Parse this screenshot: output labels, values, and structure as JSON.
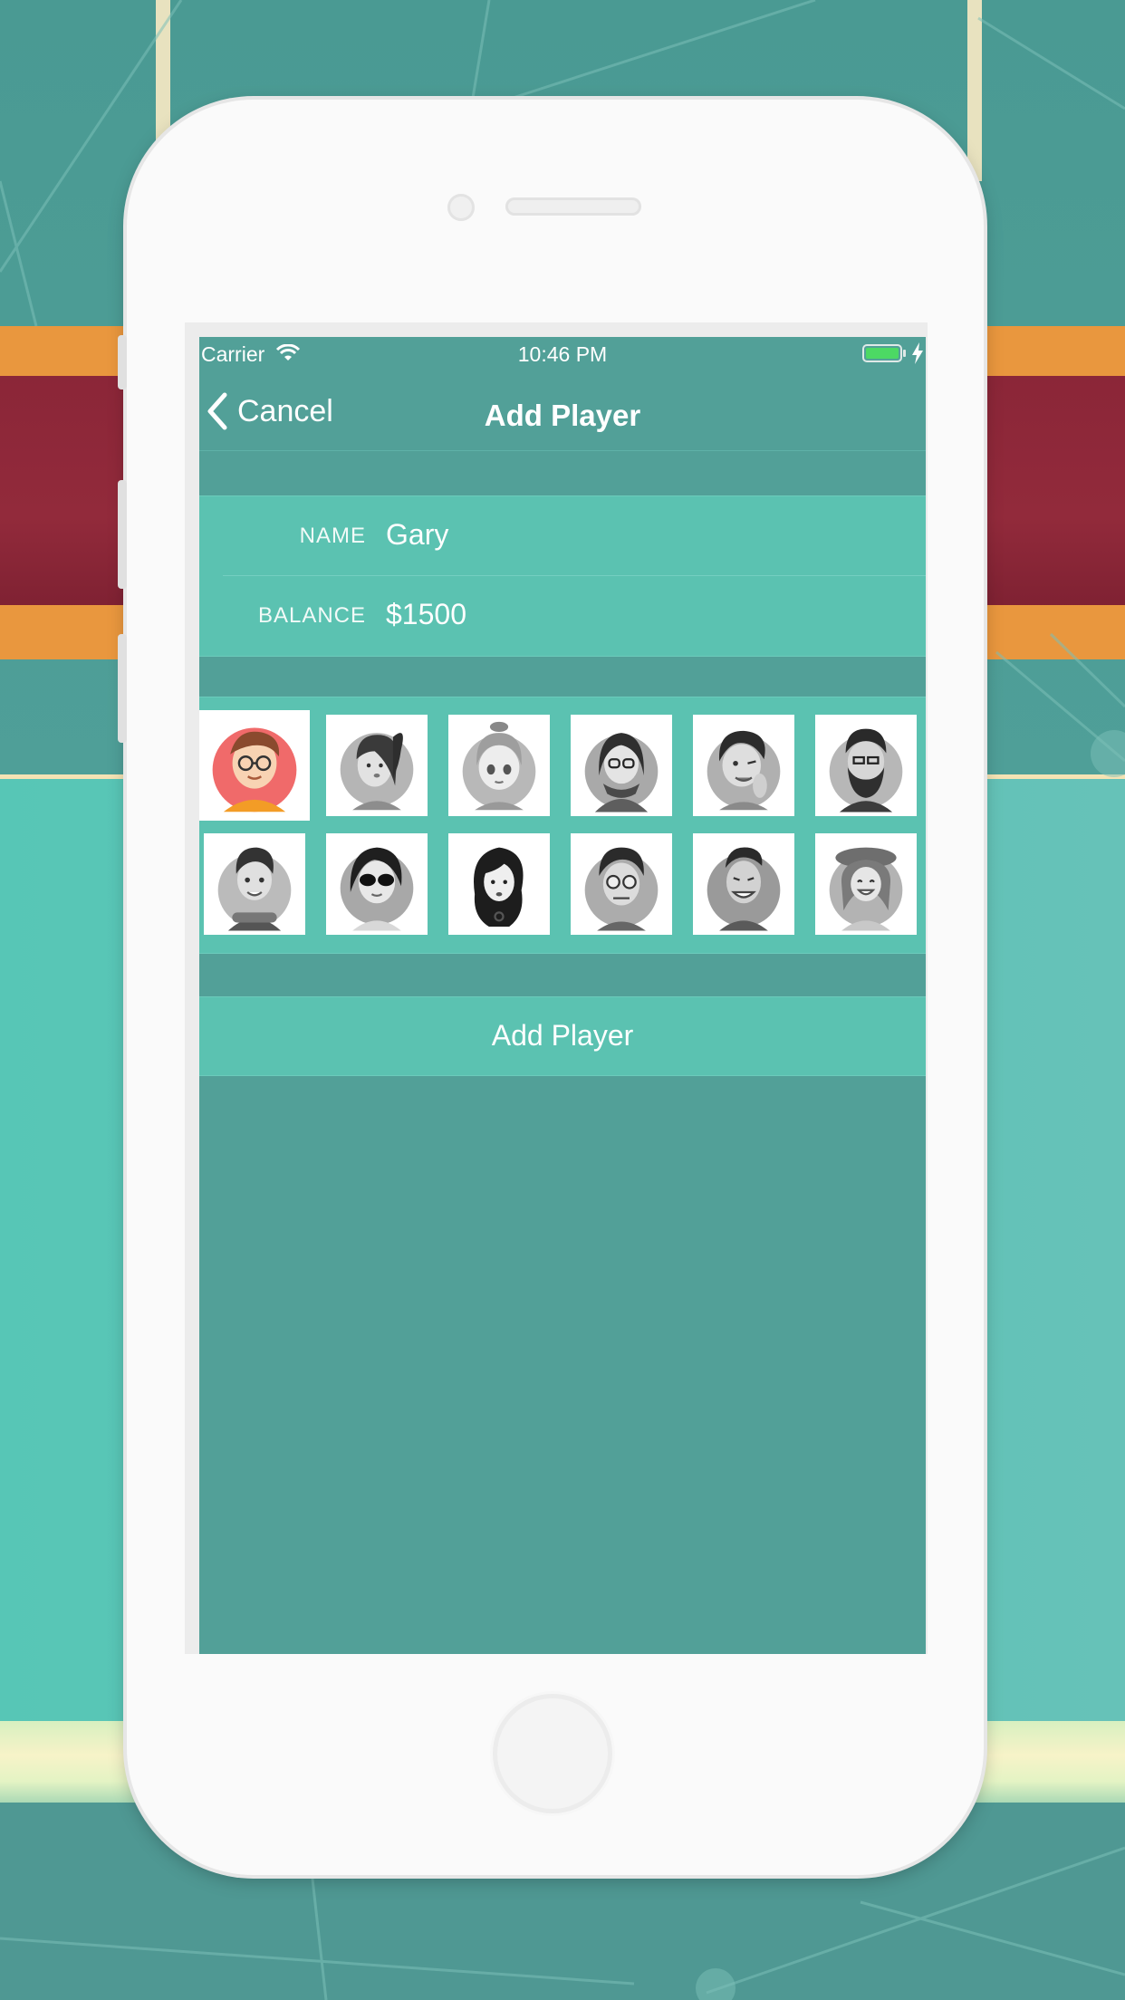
{
  "status_bar": {
    "carrier": "Carrier",
    "time": "10:46 PM",
    "icons": [
      "wifi-icon",
      "battery-icon",
      "charging-bolt-icon"
    ],
    "battery_color": "#4cd964"
  },
  "nav": {
    "back_label": "Cancel",
    "back_icon": "chevron-left-icon",
    "title": "Add Player"
  },
  "form": {
    "name_label": "NAME",
    "name_value": "Gary",
    "balance_label": "BALANCE",
    "balance_value": "$1500"
  },
  "avatars": {
    "selected_index": 0,
    "items": [
      {
        "name": "boy-glasses-avatar",
        "selected": true
      },
      {
        "name": "girl-ponytail-avatar",
        "selected": false
      },
      {
        "name": "girl-bun-avatar",
        "selected": false
      },
      {
        "name": "girl-glasses-scarf-avatar",
        "selected": false
      },
      {
        "name": "guy-tongue-avatar",
        "selected": false
      },
      {
        "name": "bearded-man-avatar",
        "selected": false
      },
      {
        "name": "boy-crossed-arms-avatar",
        "selected": false
      },
      {
        "name": "girl-sunglasses-avatar",
        "selected": false
      },
      {
        "name": "girl-long-hair-avatar",
        "selected": false
      },
      {
        "name": "man-round-glasses-avatar",
        "selected": false
      },
      {
        "name": "man-grin-avatar",
        "selected": false
      },
      {
        "name": "woman-hat-avatar",
        "selected": false
      }
    ]
  },
  "action": {
    "add_label": "Add Player"
  },
  "colors": {
    "screen_bg": "#52a098",
    "section_bg": "#5bc2b1",
    "selected_avatar_bg": "#f06a6a",
    "background_red_band": "#8b2638",
    "background_orange_band": "#e9973e"
  }
}
